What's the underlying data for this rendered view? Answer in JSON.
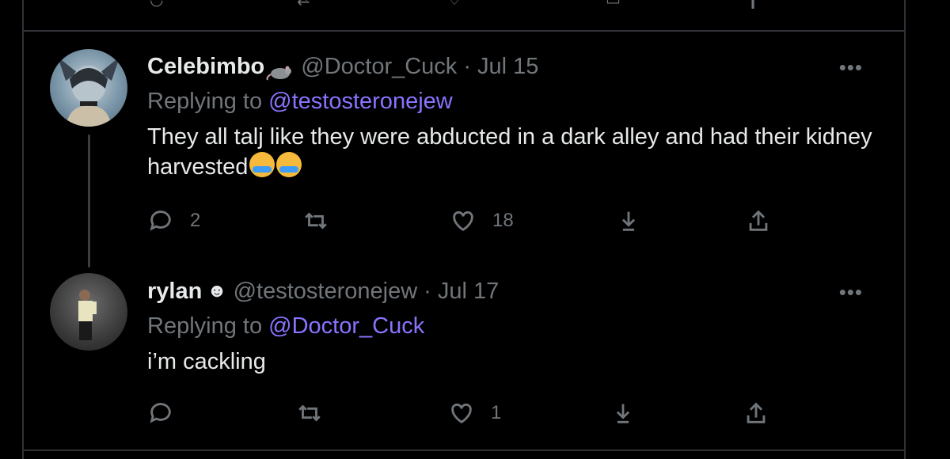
{
  "tweets": [
    {
      "name": "Celebimbo",
      "badge_icon": "rat-icon",
      "handle": "@Doctor_Cuck",
      "date": "Jul 15",
      "replying_prefix": "Replying to ",
      "replying_to": "@testosteronejew",
      "text": "They all talj like they were abducted in a dark alley and had their kidney harvested",
      "emojis": [
        "loudly-crying-face",
        "loudly-crying-face"
      ],
      "actions": {
        "replies": "2",
        "retweets": "",
        "likes": "18"
      }
    },
    {
      "name": "rylan",
      "badge_icon": "smiley-icon",
      "handle": "@testosteronejew",
      "date": "Jul 17",
      "replying_prefix": "Replying to ",
      "replying_to": "@Doctor_Cuck",
      "text": "i’m cackling",
      "emojis": [],
      "actions": {
        "replies": "",
        "retweets": "",
        "likes": "1"
      }
    }
  ],
  "separator": "·",
  "more_label": "•••",
  "colors": {
    "background": "#000000",
    "text": "#e7e9ea",
    "muted": "#71767b",
    "mention": "#8a73ff",
    "border": "#2f3336"
  }
}
